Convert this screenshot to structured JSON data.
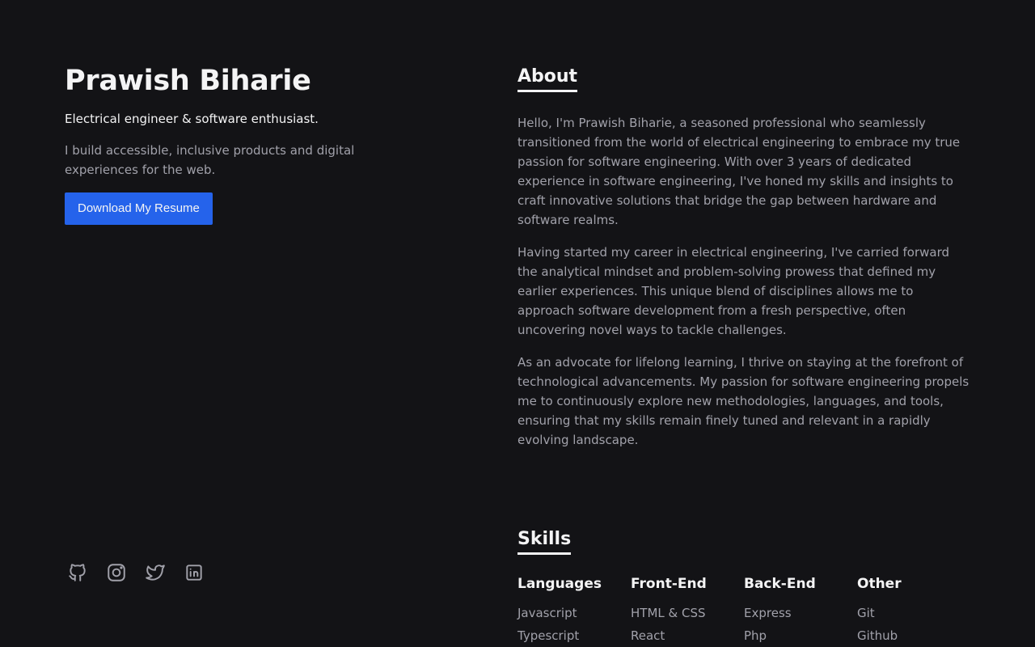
{
  "hero": {
    "name": "Prawish Biharie",
    "tagline": "Electrical engineer & software enthusiast.",
    "intro": "I build accessible, inclusive products and digital experiences for the web.",
    "resume_label": "Download My Resume"
  },
  "socials": [
    {
      "icon": "github-icon"
    },
    {
      "icon": "instagram-icon"
    },
    {
      "icon": "twitter-icon"
    },
    {
      "icon": "linkedin-icon"
    }
  ],
  "about": {
    "title": "About",
    "paragraphs": [
      "Hello, I'm Prawish Biharie, a seasoned professional who seamlessly transitioned from the world of electrical engineering to embrace my true passion for software engineering. With over 3 years of dedicated experience in software engineering, I've honed my skills and insights to craft innovative solutions that bridge the gap between hardware and software realms.",
      "Having started my career in electrical engineering, I've carried forward the analytical mindset and problem-solving prowess that defined my earlier experiences. This unique blend of disciplines allows me to approach software development from a fresh perspective, often uncovering novel ways to tackle challenges.",
      "As an advocate for lifelong learning, I thrive on staying at the forefront of technological advancements. My passion for software engineering propels me to continuously explore new methodologies, languages, and tools, ensuring that my skills remain finely tuned and relevant in a rapidly evolving landscape."
    ]
  },
  "skills": {
    "title": "Skills",
    "columns": [
      {
        "heading": "Languages",
        "items": [
          "Javascript",
          "Typescript"
        ]
      },
      {
        "heading": "Front-End",
        "items": [
          "HTML & CSS",
          "React"
        ]
      },
      {
        "heading": "Back-End",
        "items": [
          "Express",
          "Php"
        ]
      },
      {
        "heading": "Other",
        "items": [
          "Git",
          "Github"
        ]
      }
    ]
  },
  "colors": {
    "background": "#131316",
    "accent": "#2563eb",
    "heading": "#f4f4f5",
    "body_text": "#a1a1aa"
  }
}
